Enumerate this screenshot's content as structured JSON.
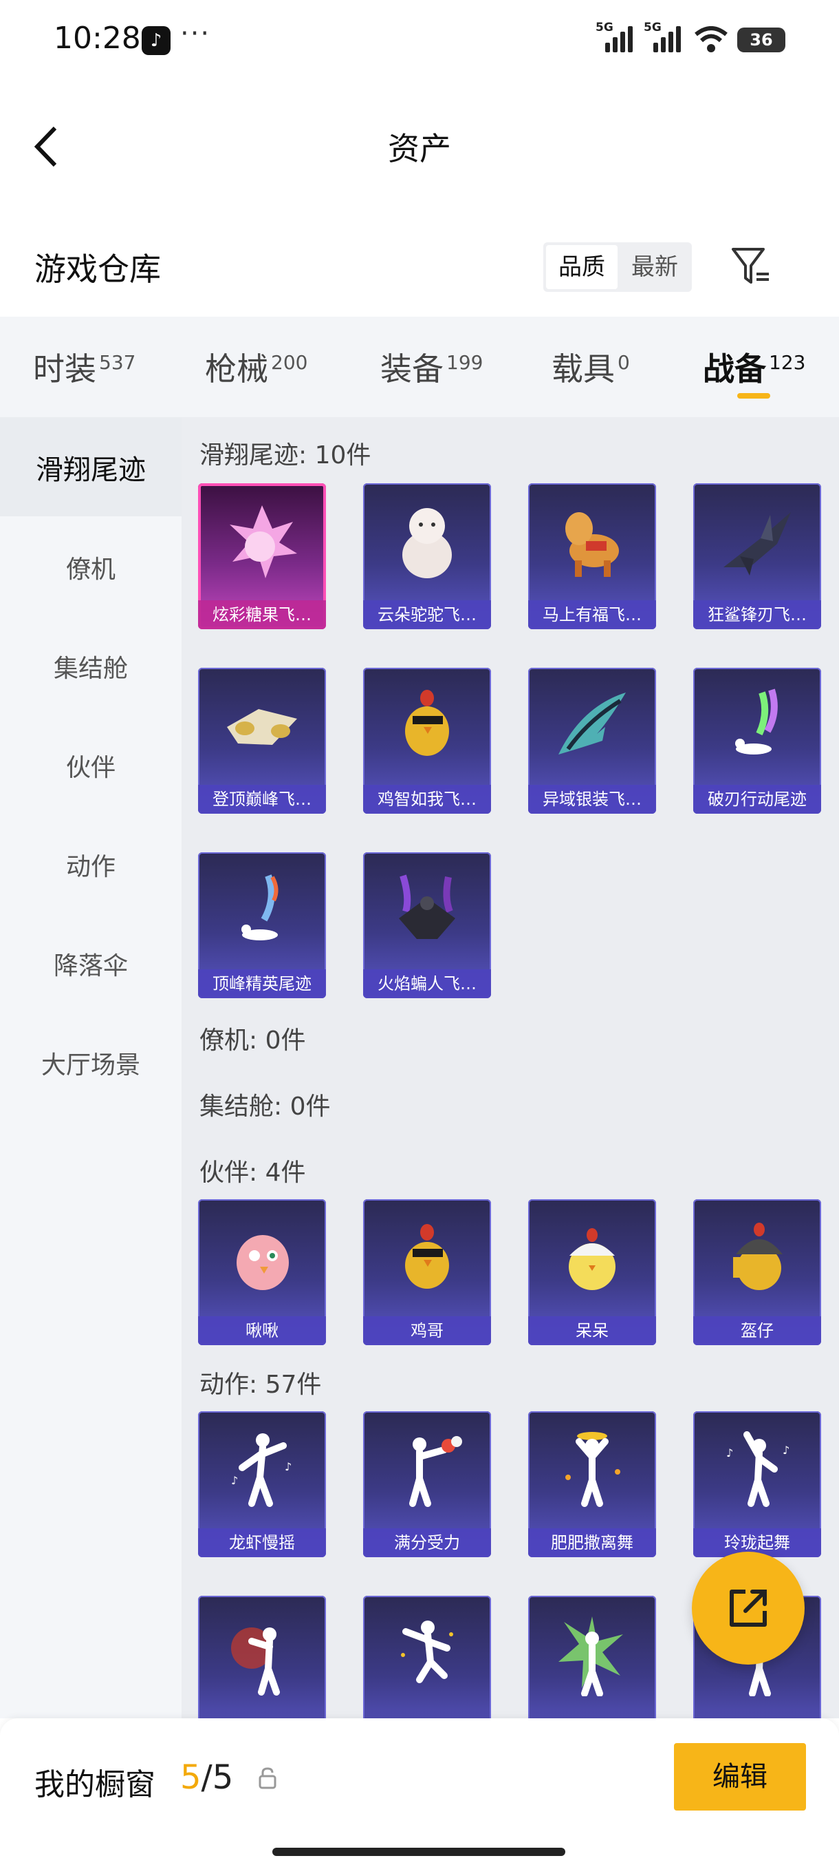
{
  "status_bar": {
    "time": "10:28",
    "signal_label_1": "5G",
    "signal_label_2": "5G",
    "battery": "36"
  },
  "header": {
    "title": "资产"
  },
  "warehouse": {
    "title": "游戏仓库",
    "sort_quality": "品质",
    "sort_newest": "最新"
  },
  "tabs": [
    {
      "label": "时装",
      "count": "537"
    },
    {
      "label": "枪械",
      "count": "200"
    },
    {
      "label": "装备",
      "count": "199"
    },
    {
      "label": "载具",
      "count": "0"
    },
    {
      "label": "战备",
      "count": "123"
    }
  ],
  "sidebar": [
    "滑翔尾迹",
    "僚机",
    "集结舱",
    "伙伴",
    "动作",
    "降落伞",
    "大厅场景"
  ],
  "sections": {
    "glide": {
      "title": "滑翔尾迹: 10件",
      "items": [
        "炫彩糖果飞…",
        "云朵驼驼飞…",
        "马上有福飞…",
        "狂鲨锋刃飞…",
        "登顶巅峰飞…",
        "鸡智如我飞…",
        "异域银装飞…",
        "破刃行动尾迹",
        "顶峰精英尾迹",
        "火焰蝙人飞…"
      ]
    },
    "wingman": {
      "title": "僚机: 0件"
    },
    "capsule": {
      "title": "集结舱: 0件"
    },
    "partner": {
      "title": "伙伴: 4件",
      "items": [
        "啾啾",
        "鸡哥",
        "呆呆",
        "盔仔"
      ]
    },
    "emote": {
      "title": "动作: 57件",
      "items": [
        "龙虾慢摇",
        "满分受力",
        "肥肥撒离舞",
        "玲珑起舞"
      ]
    }
  },
  "bottom_bar": {
    "label": "我的橱窗",
    "current": "5",
    "total": "/5",
    "edit": "编辑"
  },
  "icons": [
    "back-icon",
    "filter-icon",
    "share-icon",
    "lock-icon",
    "wifi-icon",
    "signal-icon"
  ],
  "colors": {
    "accent": "#f7b518",
    "card": "#3c3a86",
    "card_highlight": "#ff4fb6"
  }
}
